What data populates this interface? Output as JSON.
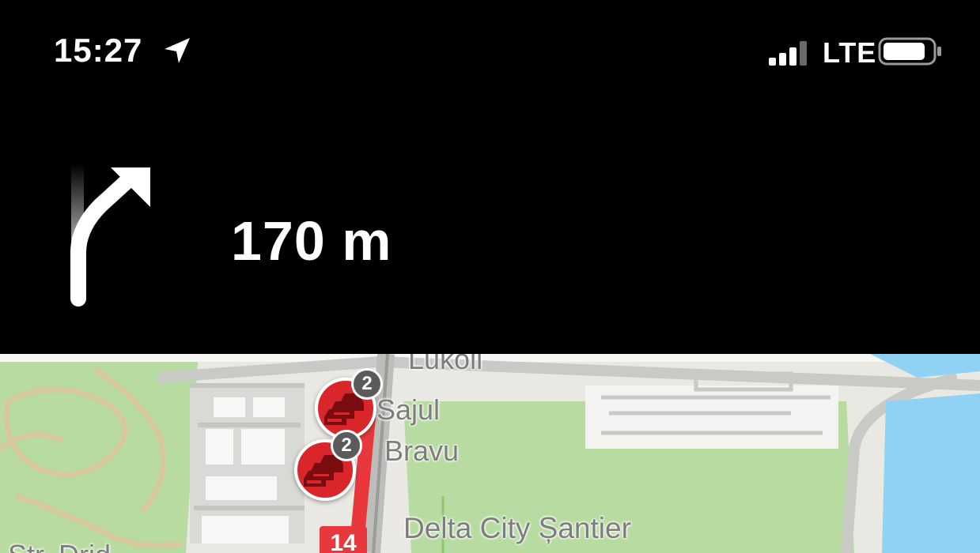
{
  "status_bar": {
    "time": "15:27",
    "network": "LTE",
    "location_icon": "location-arrow-icon",
    "signal_icon": "cellular-signal-icon",
    "battery_icon": "battery-icon"
  },
  "navigation": {
    "maneuver_icon": "bear-right-arrow-icon",
    "distance": "170 m"
  },
  "map": {
    "labels": {
      "lukoil": "Lukoil",
      "sajul": "Sajul",
      "bravu": "Bravu",
      "delta": "Delta City Șantier",
      "street": "Str. Drid..."
    },
    "traffic_markers": [
      {
        "count": "2",
        "icon": "traffic-jam-icon"
      },
      {
        "count": "2",
        "icon": "traffic-jam-icon"
      }
    ],
    "road_badge": "14"
  },
  "colors": {
    "background": "#000000",
    "traffic_red": "#d9262a",
    "park_green": "#a9d889",
    "water_blue": "#8fd2f4",
    "route_red": "#e8383d"
  }
}
